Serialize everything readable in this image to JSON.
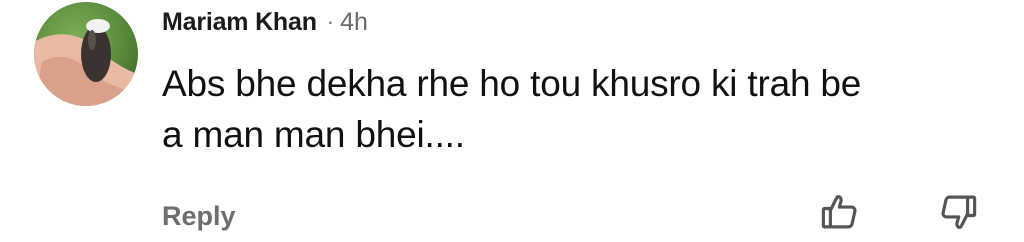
{
  "comment": {
    "author": "Mariam Khan",
    "separator": "·",
    "timestamp": "4h",
    "text_line1": "Abs bhe dekha rhe ho tou khusro ki trah be",
    "text_line2": "a man man bhei....",
    "reply_label": "Reply"
  },
  "icons": {
    "avatar": "avatar",
    "like": "thumbs-up-icon",
    "dislike": "thumbs-down-icon"
  },
  "colors": {
    "author": "#1b1b1b",
    "meta": "#6b6b6b",
    "reply": "#6e6e6e",
    "icon_stroke": "#555555"
  }
}
